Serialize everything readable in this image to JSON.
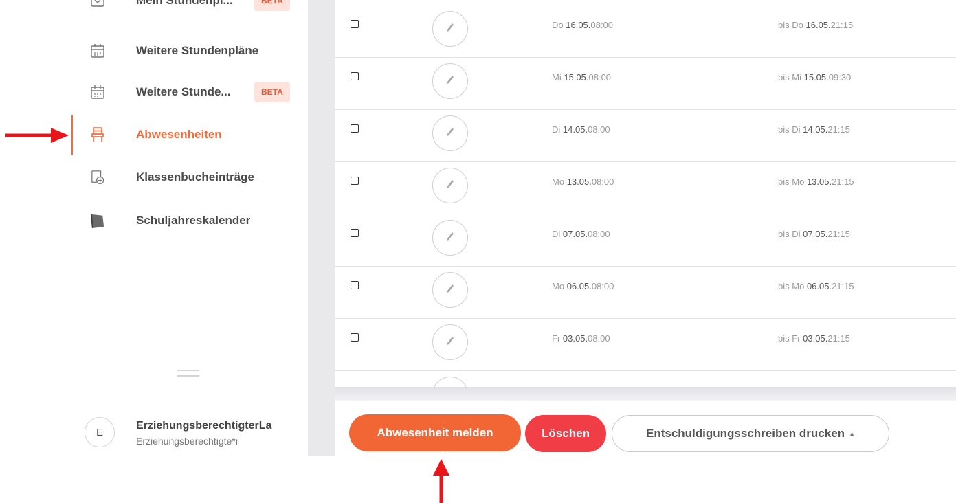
{
  "sidebar": {
    "items": [
      {
        "label": "Mein Stundenpl...",
        "icon": "timetable-icon",
        "badge": "BETA"
      },
      {
        "label": "Weitere Stundenpläne",
        "icon": "calendar-icon"
      },
      {
        "label": "Weitere Stunde...",
        "icon": "calendar-icon",
        "badge": "BETA"
      },
      {
        "label": "Abwesenheiten",
        "icon": "chair-icon",
        "active": true
      },
      {
        "label": "Klassenbucheinträge",
        "icon": "book-add-icon"
      },
      {
        "label": "Schuljahreskalender",
        "icon": "calendar-book-icon"
      }
    ],
    "user": {
      "initial": "E",
      "name": "ErziehungsberechtigterLa",
      "role": "Erziehungsberechtigte*r"
    }
  },
  "absences": [
    {
      "from_day": "Do",
      "from_date": "16.05.",
      "from_time": "08:00",
      "to_prefix": "bis",
      "to_day": "Do",
      "to_date": "16.05.",
      "to_time": "21:15"
    },
    {
      "from_day": "Mi",
      "from_date": "15.05.",
      "from_time": "08:00",
      "to_prefix": "bis",
      "to_day": "Mi",
      "to_date": "15.05.",
      "to_time": "09:30"
    },
    {
      "from_day": "Di",
      "from_date": "14.05.",
      "from_time": "08:00",
      "to_prefix": "bis",
      "to_day": "Di",
      "to_date": "14.05.",
      "to_time": "21:15"
    },
    {
      "from_day": "Mo",
      "from_date": "13.05.",
      "from_time": "08:00",
      "to_prefix": "bis",
      "to_day": "Mo",
      "to_date": "13.05.",
      "to_time": "21:15"
    },
    {
      "from_day": "Di",
      "from_date": "07.05.",
      "from_time": "08:00",
      "to_prefix": "bis",
      "to_day": "Di",
      "to_date": "07.05.",
      "to_time": "21:15"
    },
    {
      "from_day": "Mo",
      "from_date": "06.05.",
      "from_time": "08:00",
      "to_prefix": "bis",
      "to_day": "Mo",
      "to_date": "06.05.",
      "to_time": "21:15"
    },
    {
      "from_day": "Fr",
      "from_date": "03.05.",
      "from_time": "08:00",
      "to_prefix": "bis",
      "to_day": "Fr",
      "to_date": "03.05.",
      "to_time": "21:15"
    }
  ],
  "actions": {
    "report_label": "Abwesenheit melden",
    "delete_label": "Löschen",
    "print_label": "Entschuldigungsschreiben drucken"
  },
  "colors": {
    "accent": "#f26b3a",
    "delete": "#f03d46",
    "annotation_arrow": "#e8151b"
  }
}
